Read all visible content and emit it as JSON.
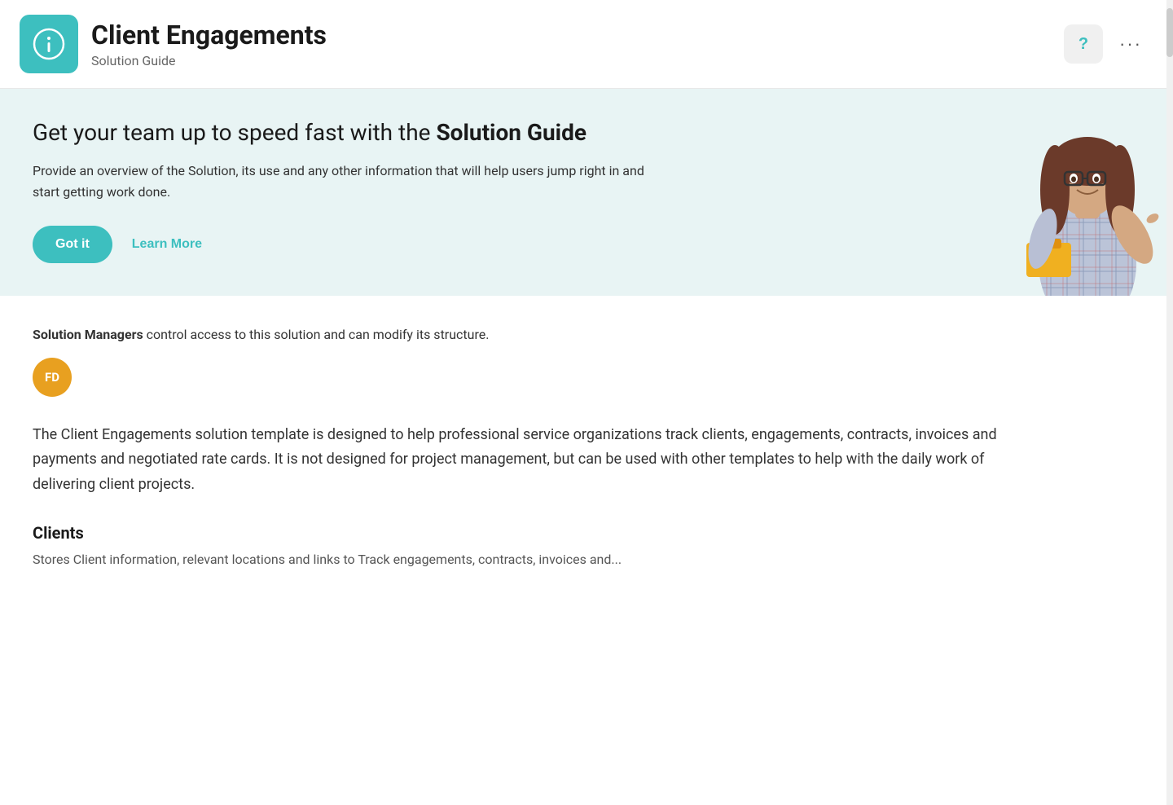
{
  "header": {
    "title": "Client Engagements",
    "subtitle": "Solution Guide",
    "icon_label": "info-icon",
    "help_label": "?",
    "more_label": "···"
  },
  "banner": {
    "heading_plain": "Get your team up to speed fast with the ",
    "heading_bold": "Solution Guide",
    "description": "Provide an overview of the Solution, its use and any other information that will help users jump right in and start getting work done.",
    "got_it_label": "Got it",
    "learn_more_label": "Learn More"
  },
  "managers": {
    "text_bold": "Solution Managers",
    "text_rest": " control access to this solution and can modify its structure.",
    "avatar_initials": "FD"
  },
  "description": {
    "body": "The Client Engagements solution template is designed to help professional service organizations track clients, engagements, contracts, invoices and payments and negotiated rate cards. It is not designed for project management, but can be used with other templates to help with the daily work of delivering client projects."
  },
  "clients_section": {
    "heading": "Clients",
    "sub_text": "Stores Client information, relevant locations and links to Track engagements, contracts, invoices and..."
  },
  "colors": {
    "teal": "#3dbfbf",
    "banner_bg": "#e8f4f4",
    "avatar_bg": "#e8a020"
  }
}
